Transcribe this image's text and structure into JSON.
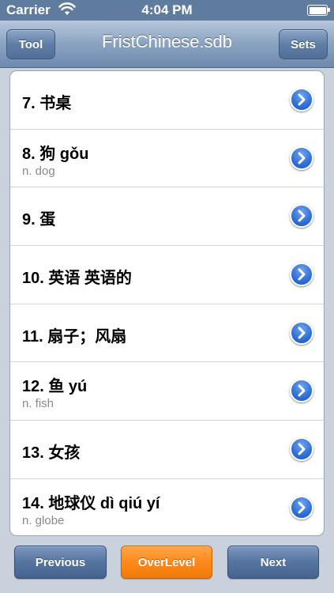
{
  "status_bar": {
    "carrier": "Carrier",
    "time": "4:04 PM",
    "wifi_icon": "wifi-icon",
    "battery_icon": "battery-icon"
  },
  "nav": {
    "title": "FristChinese.sdb",
    "left_button": "Tool",
    "right_button": "Sets"
  },
  "list": {
    "items": [
      {
        "title": "7. 书桌",
        "subtitle": ""
      },
      {
        "title": "8. 狗  gǒu",
        "subtitle": "n. dog"
      },
      {
        "title": "9. 蛋",
        "subtitle": ""
      },
      {
        "title": "10. 英语 英语的",
        "subtitle": ""
      },
      {
        "title": "11. 扇子；风扇",
        "subtitle": ""
      },
      {
        "title": "12. 鱼  yú",
        "subtitle": "n. fish"
      },
      {
        "title": "13. 女孩",
        "subtitle": ""
      },
      {
        "title": "14. 地球仪  dì qiú yí",
        "subtitle": "n. globe"
      }
    ],
    "disclosure_icon": "chevron-right-icon"
  },
  "toolbar": {
    "previous": "Previous",
    "overlevel": "OverLevel",
    "next": "Next"
  },
  "colors": {
    "accent_orange": "#ff8a1a",
    "nav_blue": "#6d89ad",
    "disclosure_blue": "#2f6fd6"
  }
}
